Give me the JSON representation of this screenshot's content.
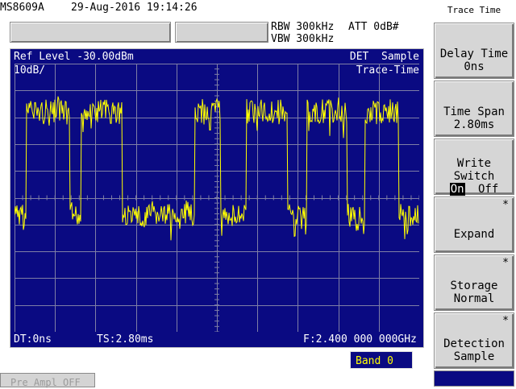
{
  "header": {
    "model": "MS8609A",
    "datetime": "29-Aug-2016 19:14:26",
    "rbw": "RBW 300kHz",
    "att": "ATT 0dB#",
    "vbw": "VBW 300kHz"
  },
  "screen": {
    "ref_level": "Ref Level -30.00dBm",
    "det": "DET  Sample",
    "scale": "10dB/",
    "mode": "Trace-Time",
    "dt": "DT:0ns",
    "ts": "TS:2.80ms",
    "freq": "F:2.400 000 000GHz"
  },
  "band_label": "Band 0",
  "pre_ampl": "Pre Ampl OFF",
  "softkeys": {
    "title": "Trace Time",
    "delay_line1": "Delay Time",
    "delay_line2": "0ns",
    "span_line1": "Time Span",
    "span_line2": "2.80ms",
    "write_line1": "Write",
    "write_line2": "Switch",
    "write_on": "On",
    "write_off": "Off",
    "expand": "Expand",
    "storage_line1": "Storage",
    "storage_line2": "Normal",
    "detection_line1": "Detection",
    "detection_line2": "Sample",
    "star": "*"
  },
  "colors": {
    "screen_bg": "#0a0a82",
    "trace": "#ffff00",
    "grid": "#7f7fa6"
  }
}
